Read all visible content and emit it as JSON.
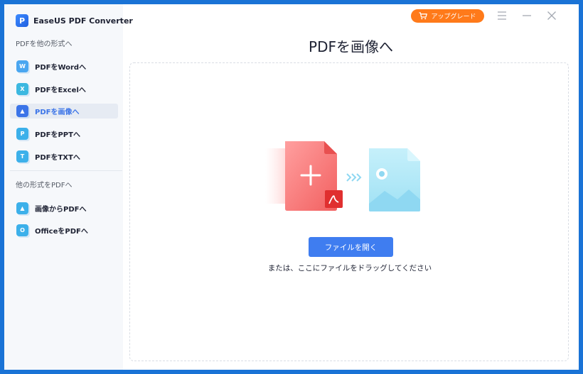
{
  "app": {
    "name": "EaseUS PDF Converter"
  },
  "sidebar": {
    "section_from_pdf": "PDFを他の形式へ",
    "section_to_pdf": "他の形式をPDFへ",
    "from_pdf_items": [
      {
        "label": "PDFをWordへ",
        "icon": "word-icon",
        "glyph": "W",
        "color": "#4aa6f0",
        "active": false
      },
      {
        "label": "PDFをExcelへ",
        "icon": "excel-icon",
        "glyph": "X",
        "color": "#3cb8e0",
        "active": false
      },
      {
        "label": "PDFを画像へ",
        "icon": "image-icon",
        "glyph": "▲",
        "color": "#3b74e8",
        "active": true
      },
      {
        "label": "PDFをPPTへ",
        "icon": "ppt-icon",
        "glyph": "P",
        "color": "#3cb0ea",
        "active": false
      },
      {
        "label": "PDFをTXTへ",
        "icon": "txt-icon",
        "glyph": "T",
        "color": "#3cb0ea",
        "active": false
      }
    ],
    "to_pdf_items": [
      {
        "label": "画像からPDFへ",
        "icon": "image-to-pdf-icon",
        "glyph": "▲",
        "color": "#3cb0ea"
      },
      {
        "label": "OfficeをPDFへ",
        "icon": "office-icon",
        "glyph": "O",
        "color": "#3cb0ea"
      }
    ]
  },
  "header": {
    "upgrade_label": "アップグレード",
    "upgrade_icon": "cart-icon",
    "accent_color": "#ff7a1a"
  },
  "main": {
    "title": "PDFを画像へ",
    "open_button": "ファイルを開く",
    "drop_hint": "または、ここにファイルをドラッグしてください"
  }
}
